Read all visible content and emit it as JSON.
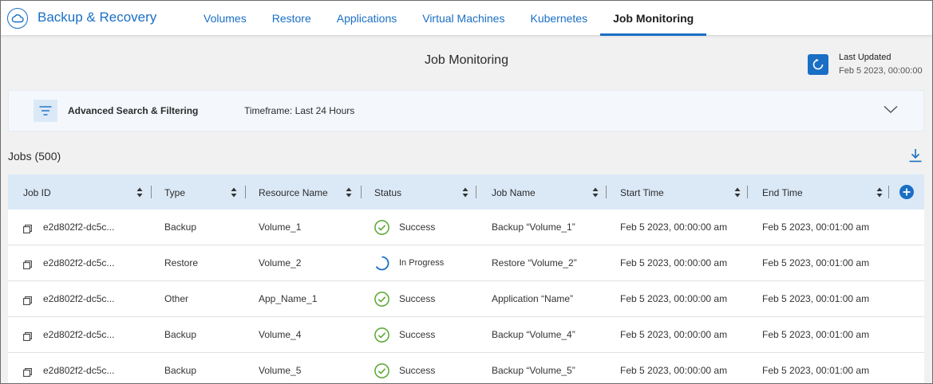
{
  "header": {
    "app_title": "Backup & Recovery",
    "nav": [
      "Volumes",
      "Restore",
      "Applications",
      "Virtual Machines",
      "Kubernetes",
      "Job Monitoring"
    ],
    "active_nav": "Job Monitoring"
  },
  "page": {
    "title": "Job Monitoring",
    "last_updated_label": "Last Updated",
    "last_updated_value": "Feb 5 2023, 00:00:00"
  },
  "filter": {
    "label": "Advanced Search & Filtering",
    "timeframe": "Timeframe: Last 24 Hours"
  },
  "jobs": {
    "title": "Jobs (500)"
  },
  "table": {
    "columns": [
      "Job ID",
      "Type",
      "Resource Name",
      "Status",
      "Job Name",
      "Start Time",
      "End Time"
    ],
    "rows": [
      {
        "job_id": "e2d802f2-dc5c...",
        "type": "Backup",
        "resource": "Volume_1",
        "status": "Success",
        "job_name": "Backup “Volume_1”",
        "start": "Feb 5 2023, 00:00:00 am",
        "end": "Feb 5 2023, 00:01:00 am"
      },
      {
        "job_id": "e2d802f2-dc5c...",
        "type": "Restore",
        "resource": "Volume_2",
        "status": "In Progress",
        "job_name": "Restore “Volume_2”",
        "start": "Feb 5 2023, 00:00:00 am",
        "end": "Feb 5 2023, 00:01:00 am"
      },
      {
        "job_id": "e2d802f2-dc5c...",
        "type": "Other",
        "resource": "App_Name_1",
        "status": "Success",
        "job_name": "Application “Name”",
        "start": "Feb 5 2023, 00:00:00 am",
        "end": "Feb 5 2023, 00:01:00 am"
      },
      {
        "job_id": "e2d802f2-dc5c...",
        "type": "Backup",
        "resource": "Volume_4",
        "status": "Success",
        "job_name": "Backup “Volume_4”",
        "start": "Feb 5 2023, 00:00:00 am",
        "end": "Feb 5 2023, 00:01:00 am"
      },
      {
        "job_id": "e2d802f2-dc5c...",
        "type": "Backup",
        "resource": "Volume_5",
        "status": "Success",
        "job_name": "Backup “Volume_5”",
        "start": "Feb 5 2023, 00:00:00 am",
        "end": "Feb 5 2023, 00:01:00 am"
      }
    ]
  },
  "colors": {
    "brand": "#1a6fc4",
    "success": "#5aa832",
    "header_bg": "#dbe9f7"
  },
  "icons": [
    "cloud-icon",
    "refresh-icon",
    "filter-icon",
    "chevron-down-icon",
    "download-icon",
    "sort-icon",
    "add-column-icon",
    "copy-icon",
    "success-check-icon",
    "in-progress-spinner-icon"
  ]
}
